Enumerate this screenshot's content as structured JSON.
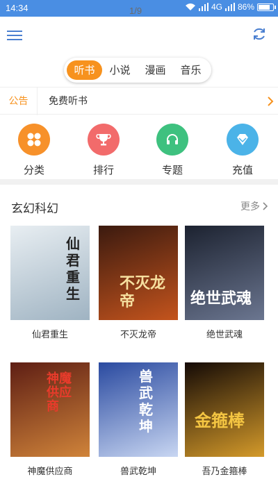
{
  "status_bar": {
    "time": "14:34",
    "page_indicator": "1/9",
    "network": "4G",
    "battery": "86%",
    "battery_level": 0.86
  },
  "header": {
    "menu_icon": "menu-icon",
    "refresh_icon": "refresh-icon"
  },
  "tabs": [
    {
      "label": "听书",
      "active": true
    },
    {
      "label": "小说",
      "active": false
    },
    {
      "label": "漫画",
      "active": false
    },
    {
      "label": "音乐",
      "active": false
    }
  ],
  "notice": {
    "label": "公告",
    "text": "免费听书"
  },
  "quick_links": [
    {
      "label": "分类",
      "icon": "grid-icon",
      "color": "#f7912a"
    },
    {
      "label": "排行",
      "icon": "trophy-icon",
      "color": "#f26b6b"
    },
    {
      "label": "专题",
      "icon": "headphones-icon",
      "color": "#3ec17f"
    },
    {
      "label": "充值",
      "icon": "diamond-icon",
      "color": "#4bb3e8"
    }
  ],
  "section": {
    "title": "玄幻科幻",
    "more_label": "更多"
  },
  "books": [
    {
      "title": "仙君重生",
      "cover_title": "仙君重生",
      "colors": [
        "#e8eef2",
        "#9fb3c2"
      ]
    },
    {
      "title": "不灭龙帝",
      "cover_title": "不灭龙帝",
      "colors": [
        "#3b1a0f",
        "#c4541d"
      ]
    },
    {
      "title": "绝世武魂",
      "cover_title": "绝世武魂",
      "colors": [
        "#1c2230",
        "#6b7690"
      ]
    },
    {
      "title": "神魔供应商",
      "cover_title": "神魔供应商",
      "colors": [
        "#5e1e14",
        "#d0843a"
      ]
    },
    {
      "title": "兽武乾坤",
      "cover_title": "兽武乾坤",
      "colors": [
        "#2a4aa0",
        "#c8d6f2"
      ]
    },
    {
      "title": "吾乃金箍棒",
      "cover_title": "金箍棒",
      "colors": [
        "#140a06",
        "#d49a2a"
      ]
    }
  ]
}
